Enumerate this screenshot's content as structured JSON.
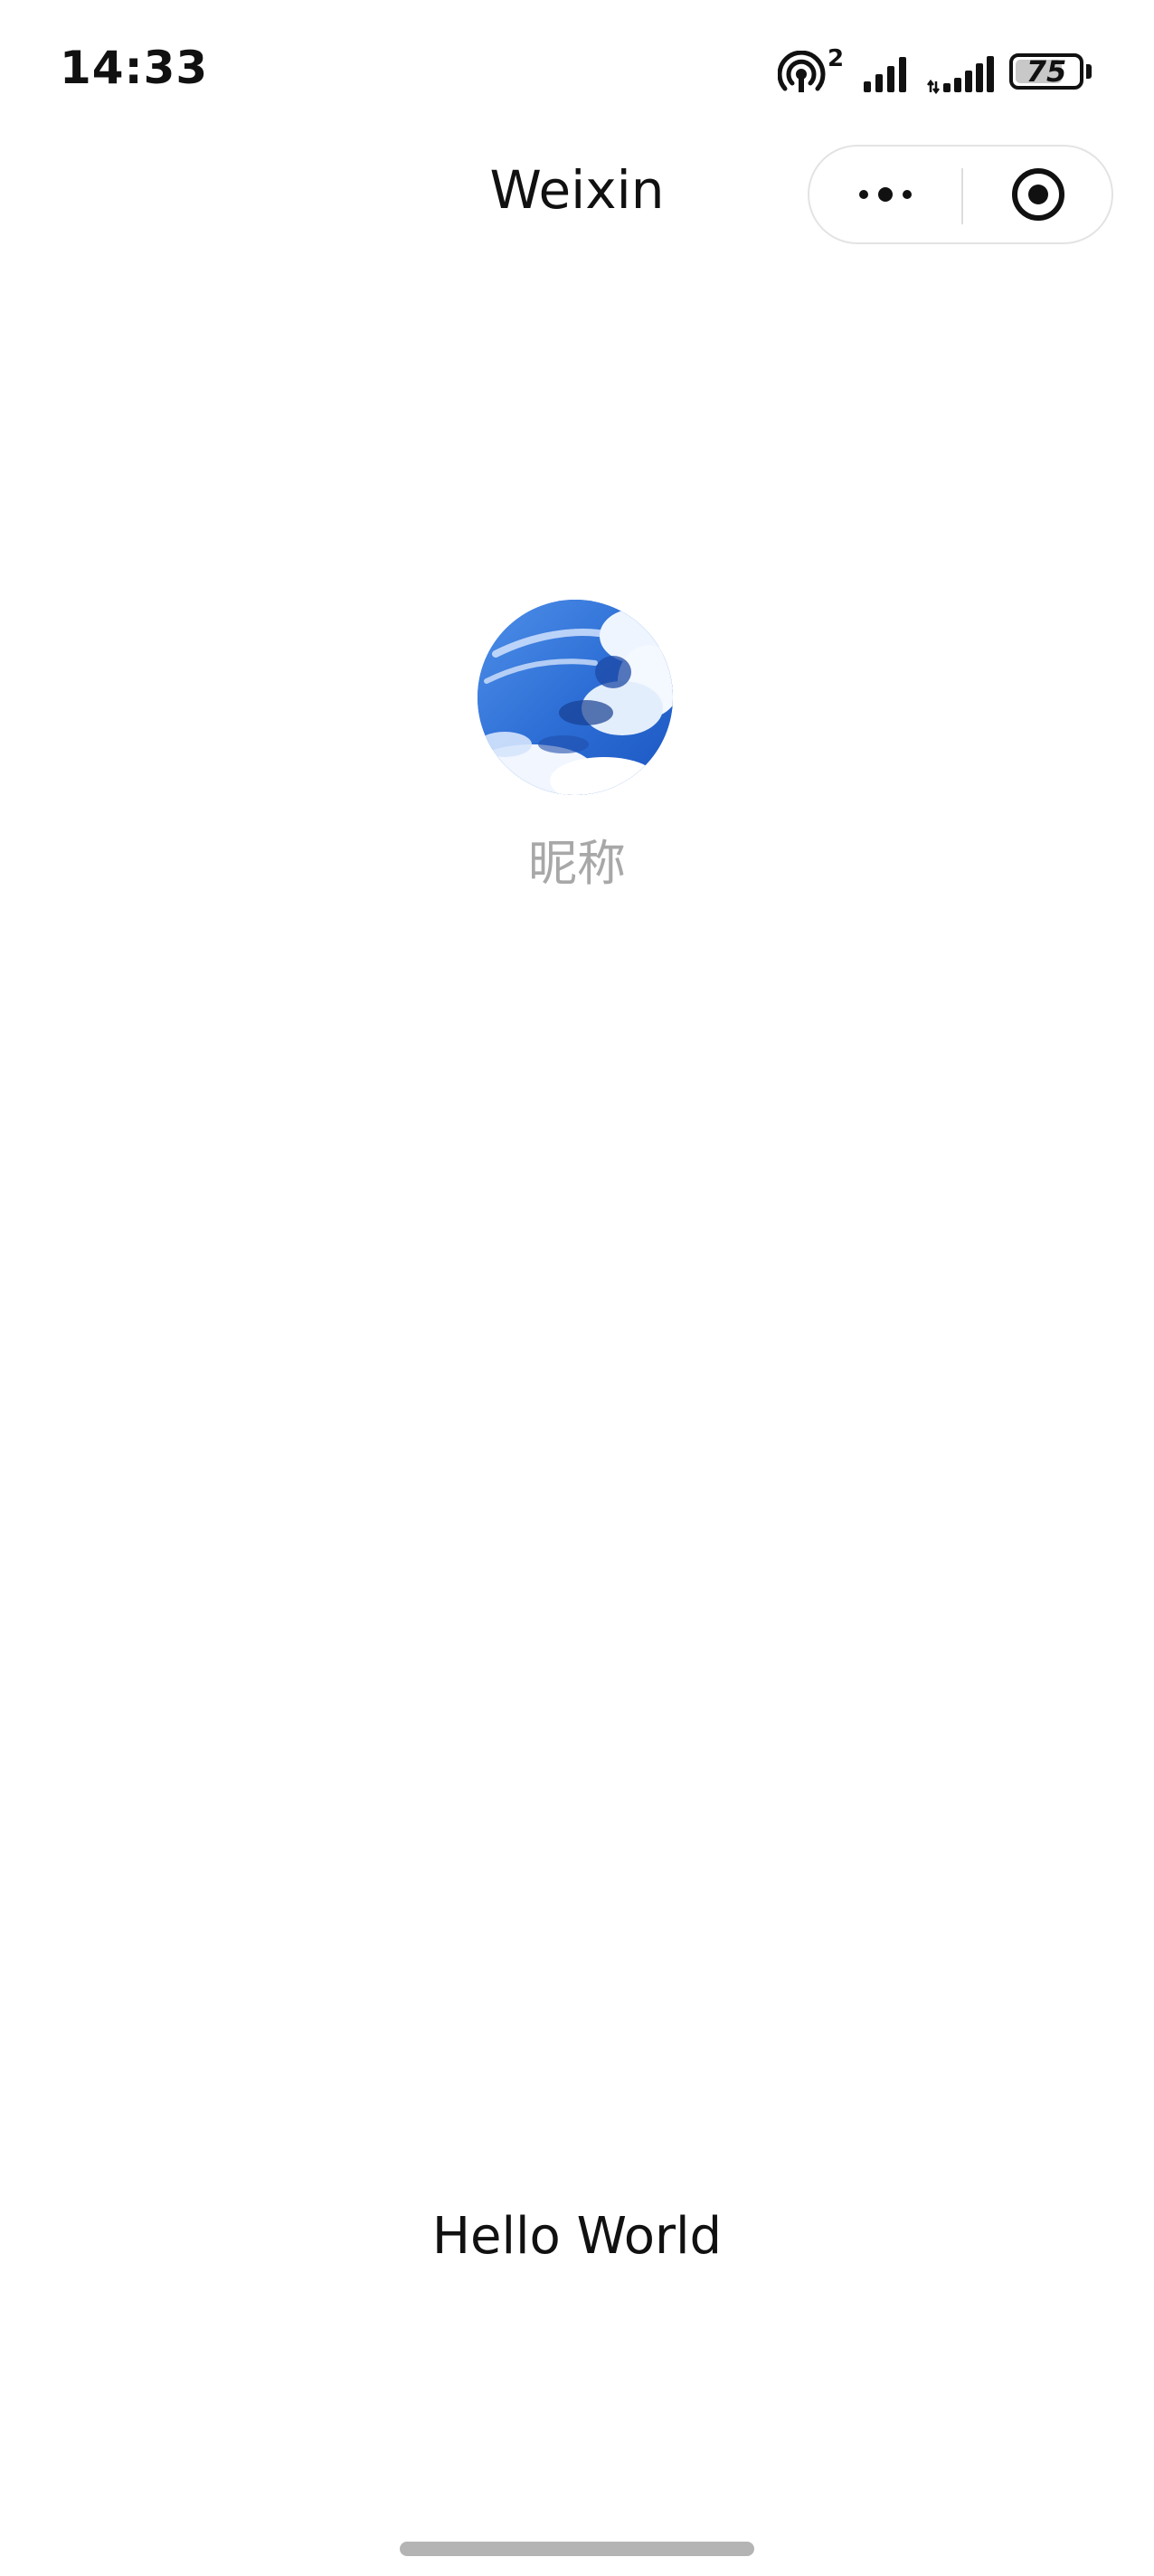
{
  "status_bar": {
    "time": "14:33",
    "hotspot_superscript": "2",
    "battery_level": "75",
    "battery_fraction": 0.75,
    "icons": [
      "hotspot-icon",
      "signal-icon",
      "signal-icon",
      "battery-icon"
    ]
  },
  "nav": {
    "title": "Weixin",
    "capsule_buttons": [
      "more-icon",
      "close-target-icon"
    ]
  },
  "profile": {
    "nickname": "昵称",
    "avatar": "sky-clouds-avatar"
  },
  "main": {
    "text": "Hello World"
  },
  "colors": {
    "background": "#ffffff",
    "nickname": "#a8a8a8",
    "text": "#111111",
    "avatar_sky": "#2f6fd8",
    "home_indicator": "#b4b4b4"
  }
}
